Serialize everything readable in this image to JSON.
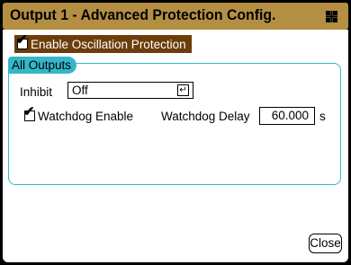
{
  "window": {
    "title": "Output 1 - Advanced Protection Config.",
    "title_icon": "grid-icon"
  },
  "oscillation": {
    "label": "Enable Oscillation Protection",
    "checked": true
  },
  "all_outputs": {
    "group_label": "All Outputs",
    "inhibit_label": "Inhibit",
    "inhibit_value": "Off",
    "enter_icon": "↵",
    "watchdog_enable_label": "Watchdog Enable",
    "watchdog_checked": true,
    "watchdog_delay_label": "Watchdog Delay",
    "watchdog_delay_value": "60.000",
    "watchdog_delay_unit": "s"
  },
  "buttons": {
    "close_label": "Close"
  },
  "colors": {
    "title_bg": "#b48f43",
    "highlight_bg": "#6c3d0a",
    "group_accent": "#34b7c8"
  }
}
